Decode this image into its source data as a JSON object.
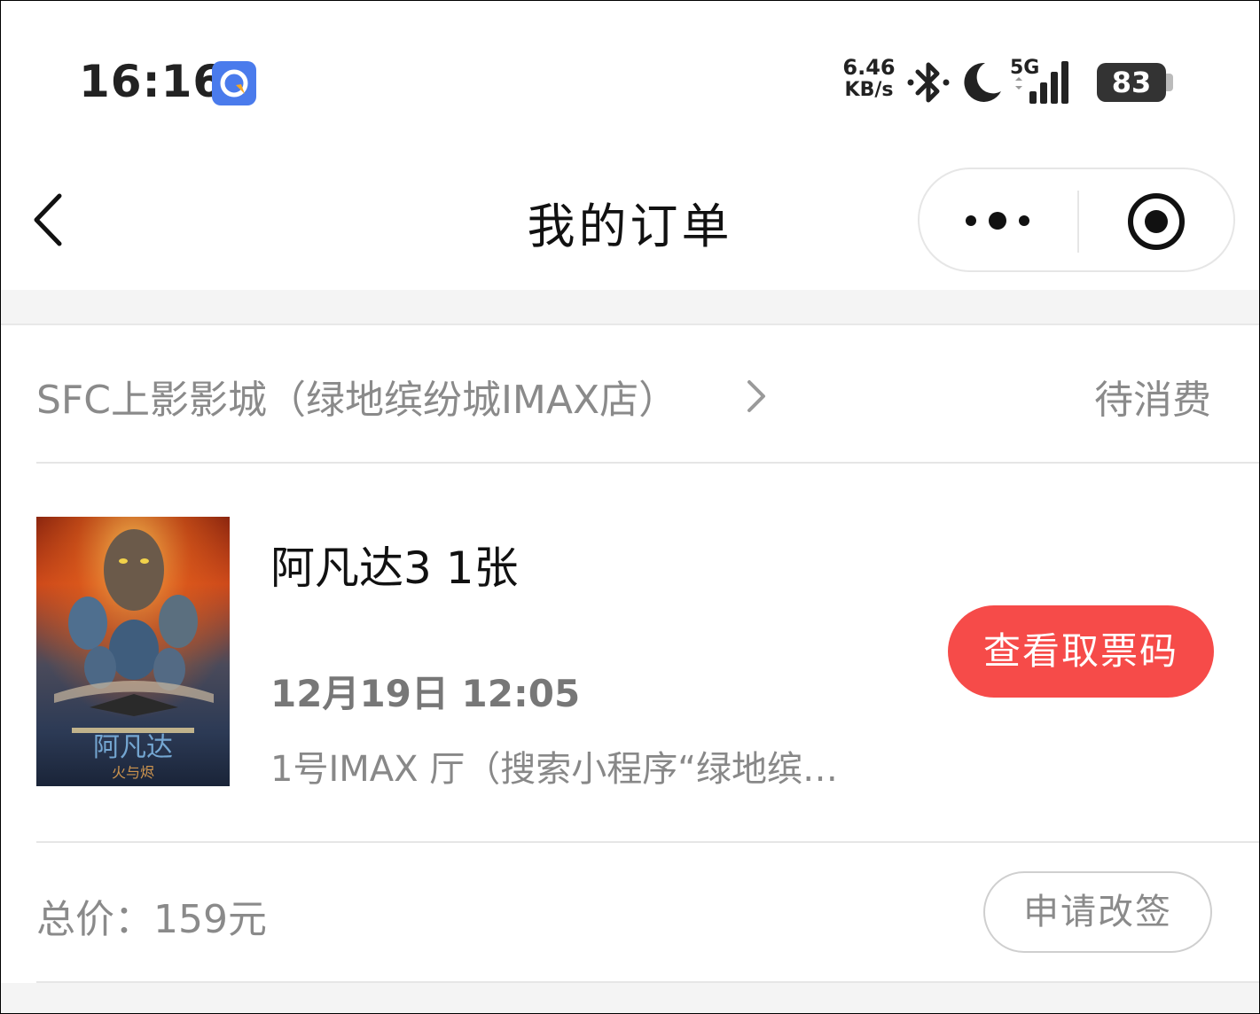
{
  "status_bar": {
    "time": "16:16",
    "app_icon": "navigation-app-icon",
    "net_speed_value": "6.46",
    "net_speed_unit": "KB/s",
    "bluetooth_icon": "bluetooth-icon",
    "dnd_icon": "moon-icon",
    "network_label": "5G",
    "battery_level": "83"
  },
  "nav": {
    "title": "我的订单",
    "back_icon": "chevron-left-icon",
    "more_icon": "more-dots-icon",
    "close_icon": "close-miniprogram-icon"
  },
  "order": {
    "cinema_name": "SFC上影影城（绿地缤纷城IMAX店）",
    "status": "待消费",
    "movie_title": "阿凡达3 1张",
    "show_time": "12月19日 12:05",
    "hall_info": "1号IMAX 厅（搜索小程序“绿地缤…",
    "ticket_code_button": "查看取票码",
    "total_price": "总价：159元",
    "reschedule_button": "申请改签"
  },
  "colors": {
    "accent_red": "#f64b49",
    "muted_text": "#8a8a8a",
    "divider": "#e6e6e6"
  }
}
